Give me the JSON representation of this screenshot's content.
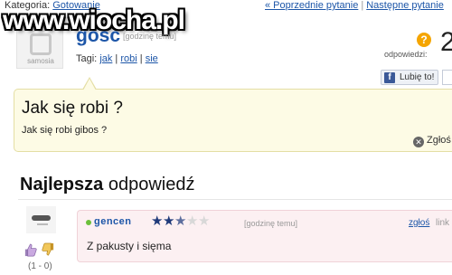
{
  "topbar": {
    "category_label": "Kategoria:",
    "category_link": "Gotowanie",
    "prev_link": "« Poprzednie pytanie",
    "separator": "|",
    "next_link": "Następne pytanie"
  },
  "watermark": {
    "text": "www.wiocha.pl"
  },
  "question": {
    "avatar_label": "samosia",
    "author": "gosc",
    "time": "[godzinę temu]",
    "tags_label": "Tagi:",
    "tags": [
      "jak",
      "robi",
      "sie"
    ],
    "answers_label": "odpowiedzi:",
    "answers_count": "2",
    "title": "Jak się robi ?",
    "body": "Jak się robi gibos ?",
    "report_label": "Zgłoś"
  },
  "facebook": {
    "like_label": "Lubię to!"
  },
  "best_answer": {
    "heading_bold": "Najlepsza",
    "heading_rest": " odpowiedź",
    "author": "gencen",
    "rating": {
      "value": 2.5,
      "max": 5
    },
    "time": "[godzinę temu]",
    "report_label": "zgłoś",
    "link_label": "link",
    "text": "Z pakusty i sięma",
    "votes": "(1 - 0)"
  },
  "colors": {
    "link": "#1d56a8",
    "question_bg": "#fdfbe5",
    "answer_bg": "#fcf0f2",
    "badge_orange": "#f5a500",
    "online_green": "#6cbf3a"
  }
}
